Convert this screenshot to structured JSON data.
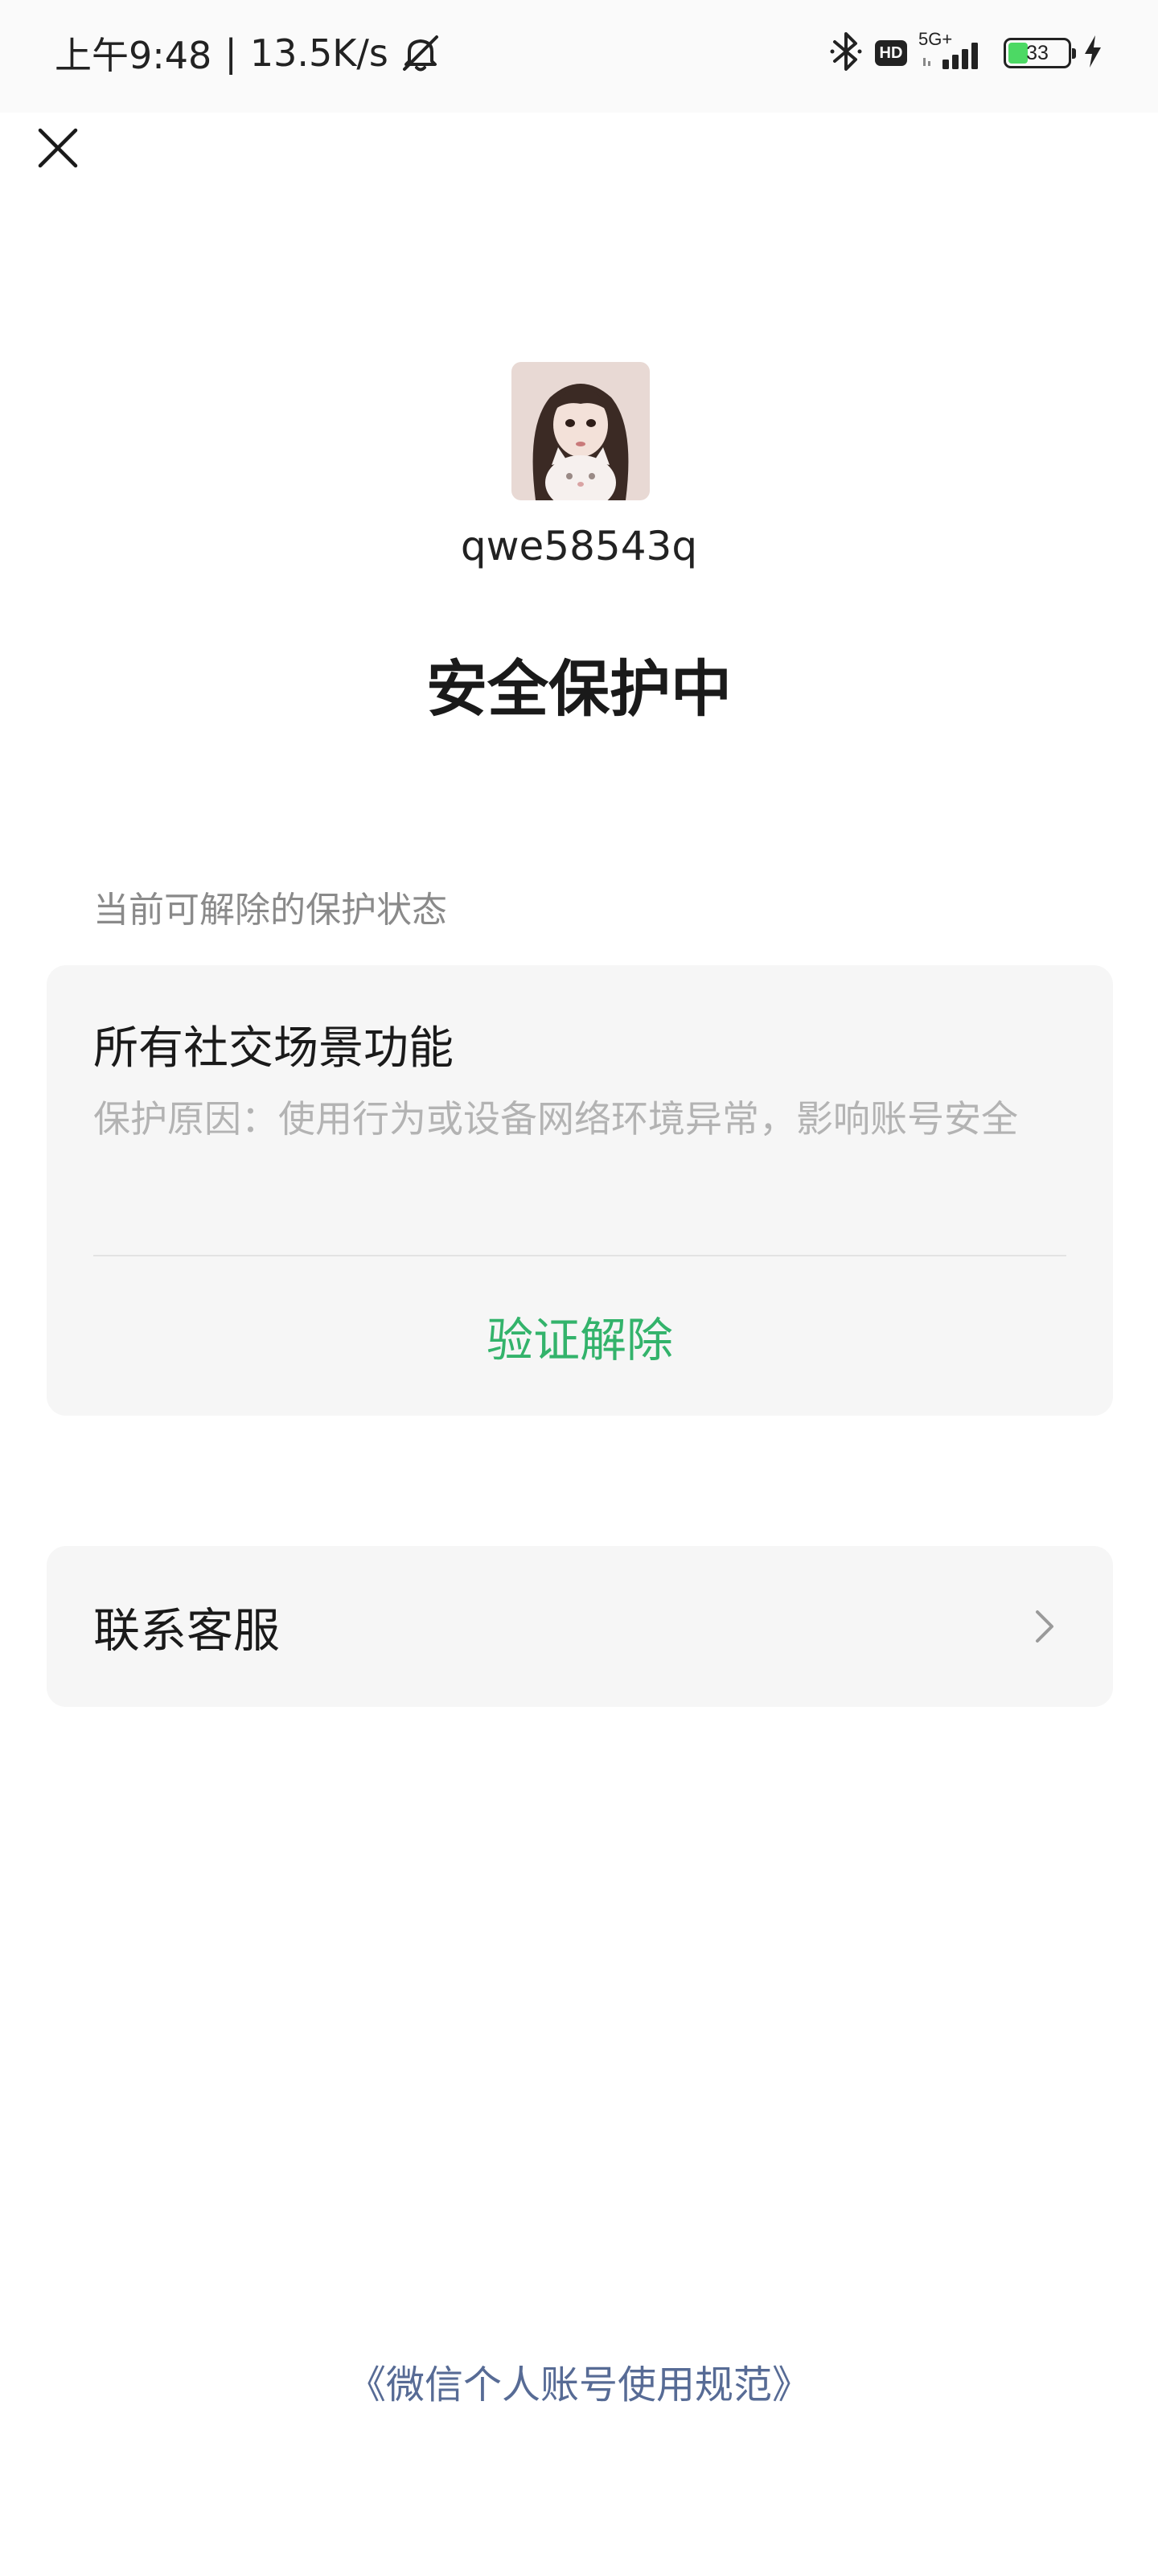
{
  "status_bar": {
    "time": "上午9:48",
    "separator": "|",
    "net_speed": "13.5K/s",
    "network_type": "5G+",
    "hd_label": "HD",
    "battery_level": "33",
    "battery_fraction": 0.33
  },
  "profile": {
    "username": "qwe58543q"
  },
  "page": {
    "title": "安全保护中"
  },
  "protection": {
    "section_label": "当前可解除的保护状态",
    "item_title": "所有社交场景功能",
    "reason": "保护原因：使用行为或设备网络环境异常，影响账号安全",
    "action_label": "验证解除"
  },
  "support": {
    "label": "联系客服"
  },
  "footer": {
    "policy_link": "《微信个人账号使用规范》"
  },
  "colors": {
    "accent_green": "#33b36b",
    "link_blue": "#576b95",
    "card_bg": "#f6f6f6",
    "secondary_text": "#b3b3b3"
  }
}
